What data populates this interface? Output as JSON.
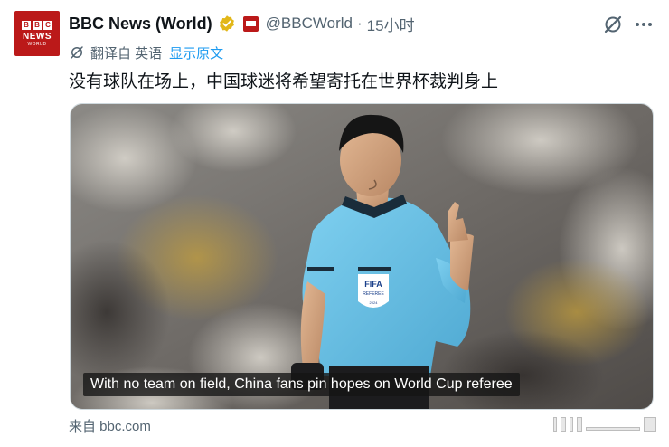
{
  "account": {
    "avatar_logo_letters": [
      "B",
      "B",
      "C"
    ],
    "avatar_logo_text": "NEWS",
    "avatar_logo_subtext": "WORLD",
    "display_name": "BBC News (World)",
    "handle": "@BBCWorld",
    "separator": "·",
    "time_ago": "15小时"
  },
  "translation": {
    "translated_from": "翻译自 英语",
    "show_original": "显示原文"
  },
  "tweet": {
    "text": "没有球队在场上，中国球迷将希望寄托在世界杯裁判身上"
  },
  "media": {
    "caption": "With no team on field, China fans pin hopes on World Cup referee",
    "badge_text": "FIFA",
    "badge_subtext": "REFEREE",
    "badge_year": "2024"
  },
  "card": {
    "source": "来自 bbc.com"
  },
  "colors": {
    "brand_red": "#bb1919",
    "verified_gold": "#e2b719",
    "link_blue": "#1d9bf0",
    "muted_text": "#536471",
    "jersey_cyan": "#6ec3e8"
  },
  "icons": {
    "verified": "verified-badge-icon",
    "affiliate": "bbc-affiliate-icon",
    "grok": "grok-icon",
    "more": "more-options-icon",
    "translate": "translate-icon"
  }
}
